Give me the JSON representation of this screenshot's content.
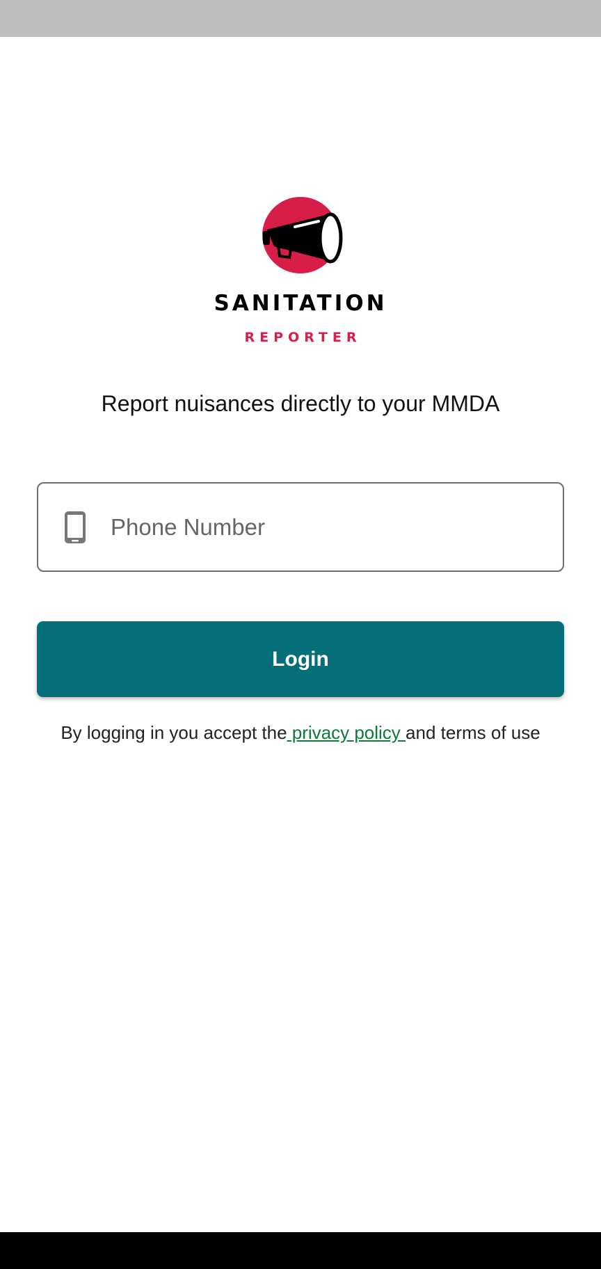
{
  "app": {
    "logo_icon": "megaphone-icon",
    "title": "SANITATION",
    "subtitle": "REPORTER",
    "tagline": "Report nuisances directly to your MMDA"
  },
  "login_form": {
    "phone_icon": "mobile-phone-icon",
    "phone_placeholder": "Phone Number",
    "phone_value": "",
    "login_label": "Login"
  },
  "legal": {
    "prefix": "By logging in you accept the",
    "link_text": " privacy policy ",
    "suffix": "and terms of use"
  },
  "colors": {
    "brand_red": "#d81e48",
    "primary_teal": "#046e79",
    "link_green": "#0d7a3a"
  }
}
